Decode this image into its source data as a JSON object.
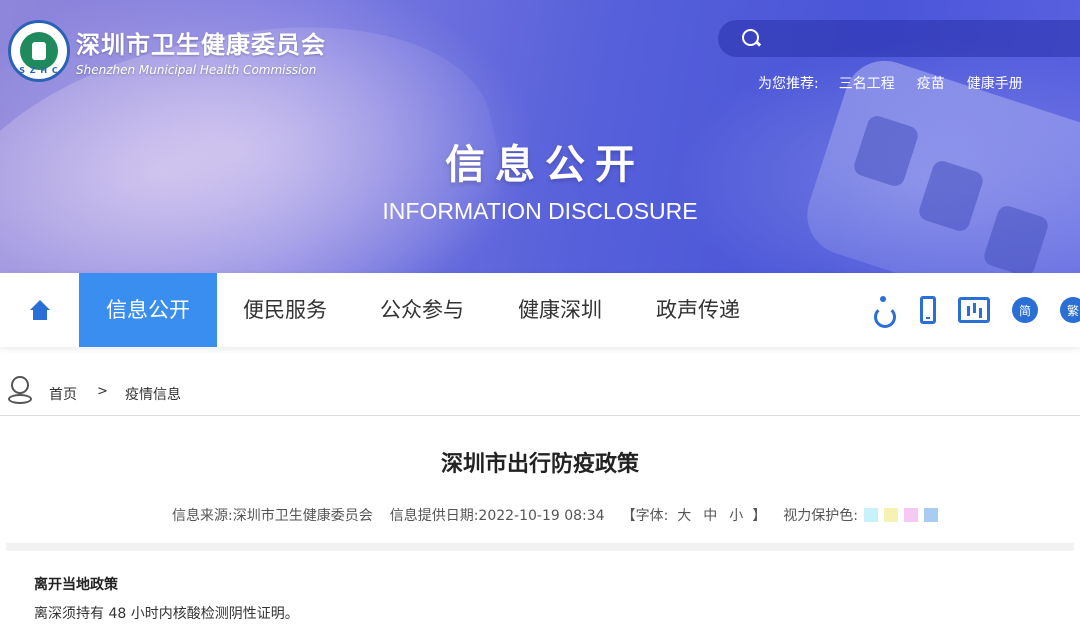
{
  "header": {
    "logo_cn": "深圳市卫生健康委员会",
    "logo_en": "Shenzhen Municipal Health Commission",
    "logo_mark_text": "S Z H C",
    "search_placeholder": "",
    "recommend_label": "为您推荐:",
    "recommend_links": [
      "三名工程",
      "疫苗",
      "健康手册"
    ],
    "banner_title": "信息公开",
    "banner_subtitle": "INFORMATION DISCLOSURE"
  },
  "nav": {
    "items": [
      "信息公开",
      "便民服务",
      "公众参与",
      "健康深圳",
      "政声传递"
    ],
    "active_index": 0,
    "tools": {
      "simplified": "简",
      "traditional": "繁"
    }
  },
  "breadcrumb": {
    "home": "首页",
    "separator": ">",
    "current": "疫情信息"
  },
  "article": {
    "title": "深圳市出行防疫政策",
    "source": "信息来源:深圳市卫生健康委员会",
    "date": "信息提供日期:2022-10-19 08:34",
    "font_open": "【字体:",
    "font_sizes": [
      "大",
      "中",
      "小"
    ],
    "font_close": "】",
    "eye_label": "视力保护色:",
    "eye_colors": [
      "#c8f2fb",
      "#f6f2b4",
      "#f7c8f4",
      "#a9cdf0"
    ],
    "section_heading": "离开当地政策",
    "paragraph": "离深须持有 48 小时内核酸检测阴性证明。"
  },
  "colors": {
    "accent": "#3a8ef0",
    "icon": "#2a6fd6"
  }
}
